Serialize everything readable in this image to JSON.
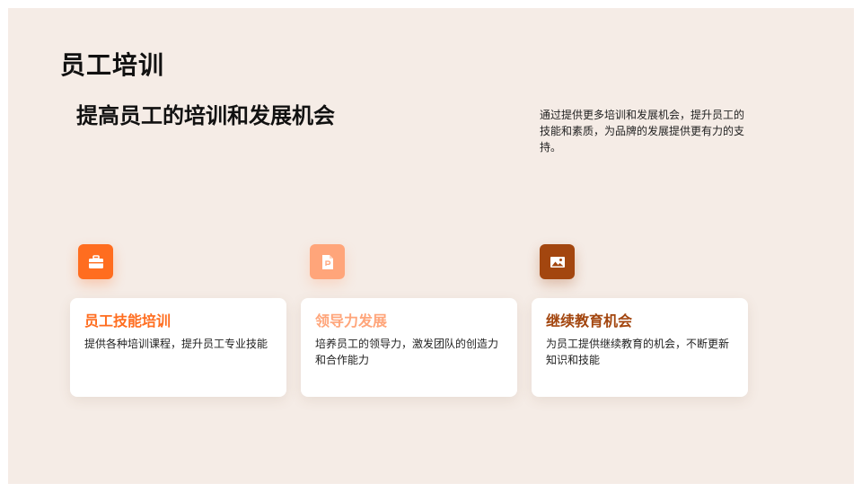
{
  "slide": {
    "title": "员工培训",
    "subtitle": "提高员工的培训和发展机会",
    "description": "通过提供更多培训和发展机会，提升员工的技能和素质，为品牌的发展提供更有力的支持。"
  },
  "cards": [
    {
      "icon": "briefcase-icon",
      "color": "#ff6d1f",
      "title": "员工技能培训",
      "text": "提供各种培训课程，提升员工专业技能"
    },
    {
      "icon": "document-icon",
      "color": "#ffa57a",
      "title": "领导力发展",
      "text": "培养员工的领导力，激发团队的创造力和合作能力"
    },
    {
      "icon": "image-icon",
      "color": "#a3460f",
      "title": "继续教育机会",
      "text": "为员工提供继续教育的机会，不断更新知识和技能"
    }
  ],
  "colors": {
    "background": "#f5ece6",
    "card": "#ffffff",
    "text": "#111111"
  }
}
